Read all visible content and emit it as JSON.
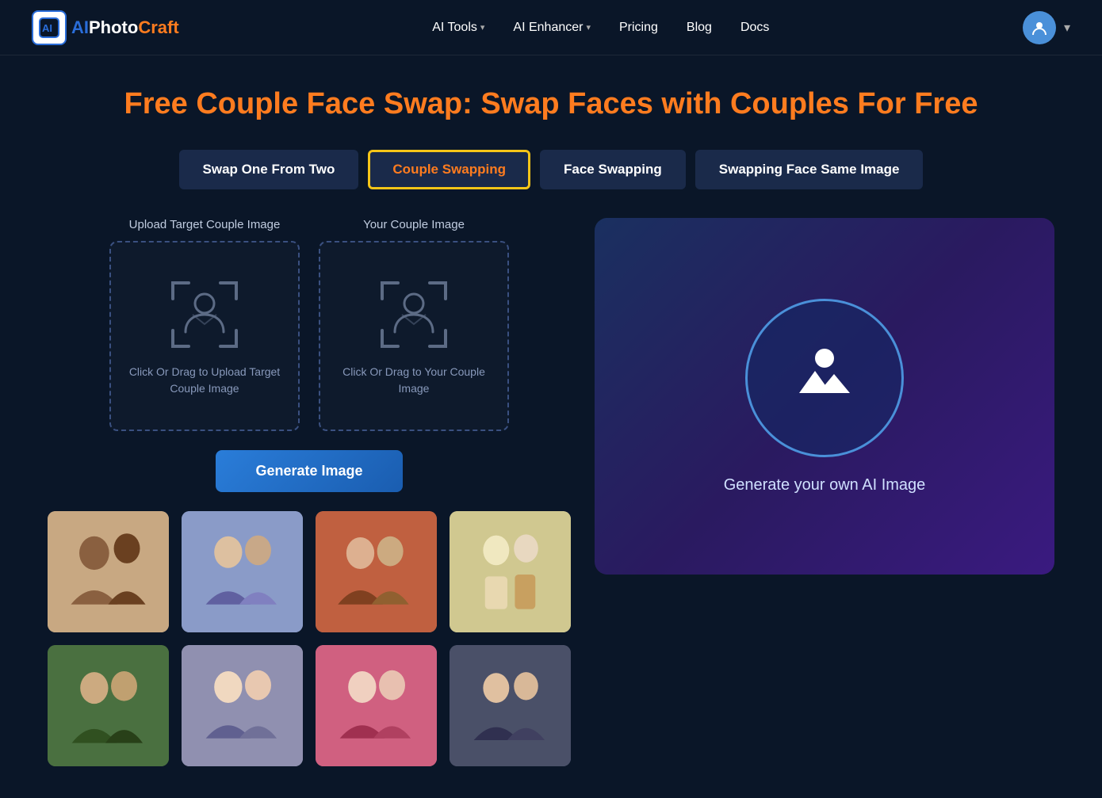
{
  "nav": {
    "logo": {
      "ai": "AI",
      "photo": "Photo",
      "craft": "Craft"
    },
    "links": [
      {
        "label": "AI Tools",
        "hasDropdown": true
      },
      {
        "label": "AI Enhancer",
        "hasDropdown": true
      },
      {
        "label": "Pricing",
        "hasDropdown": false
      },
      {
        "label": "Blog",
        "hasDropdown": false
      },
      {
        "label": "Docs",
        "hasDropdown": false
      }
    ]
  },
  "page": {
    "title": "Free Couple Face Swap: Swap Faces with Couples For Free"
  },
  "tabs": [
    {
      "label": "Swap One From Two",
      "active": false
    },
    {
      "label": "Couple Swapping",
      "active": true
    },
    {
      "label": "Face Swapping",
      "active": false
    },
    {
      "label": "Swapping Face Same Image",
      "active": false
    }
  ],
  "upload": {
    "target_label": "Upload Target Couple Image",
    "your_label": "Your Couple Image",
    "target_text": "Click Or Drag to Upload Target Couple Image",
    "your_text": "Click Or Drag to Your Couple Image"
  },
  "generate_btn": "Generate Image",
  "right_panel": {
    "label": "Generate your own AI Image"
  }
}
